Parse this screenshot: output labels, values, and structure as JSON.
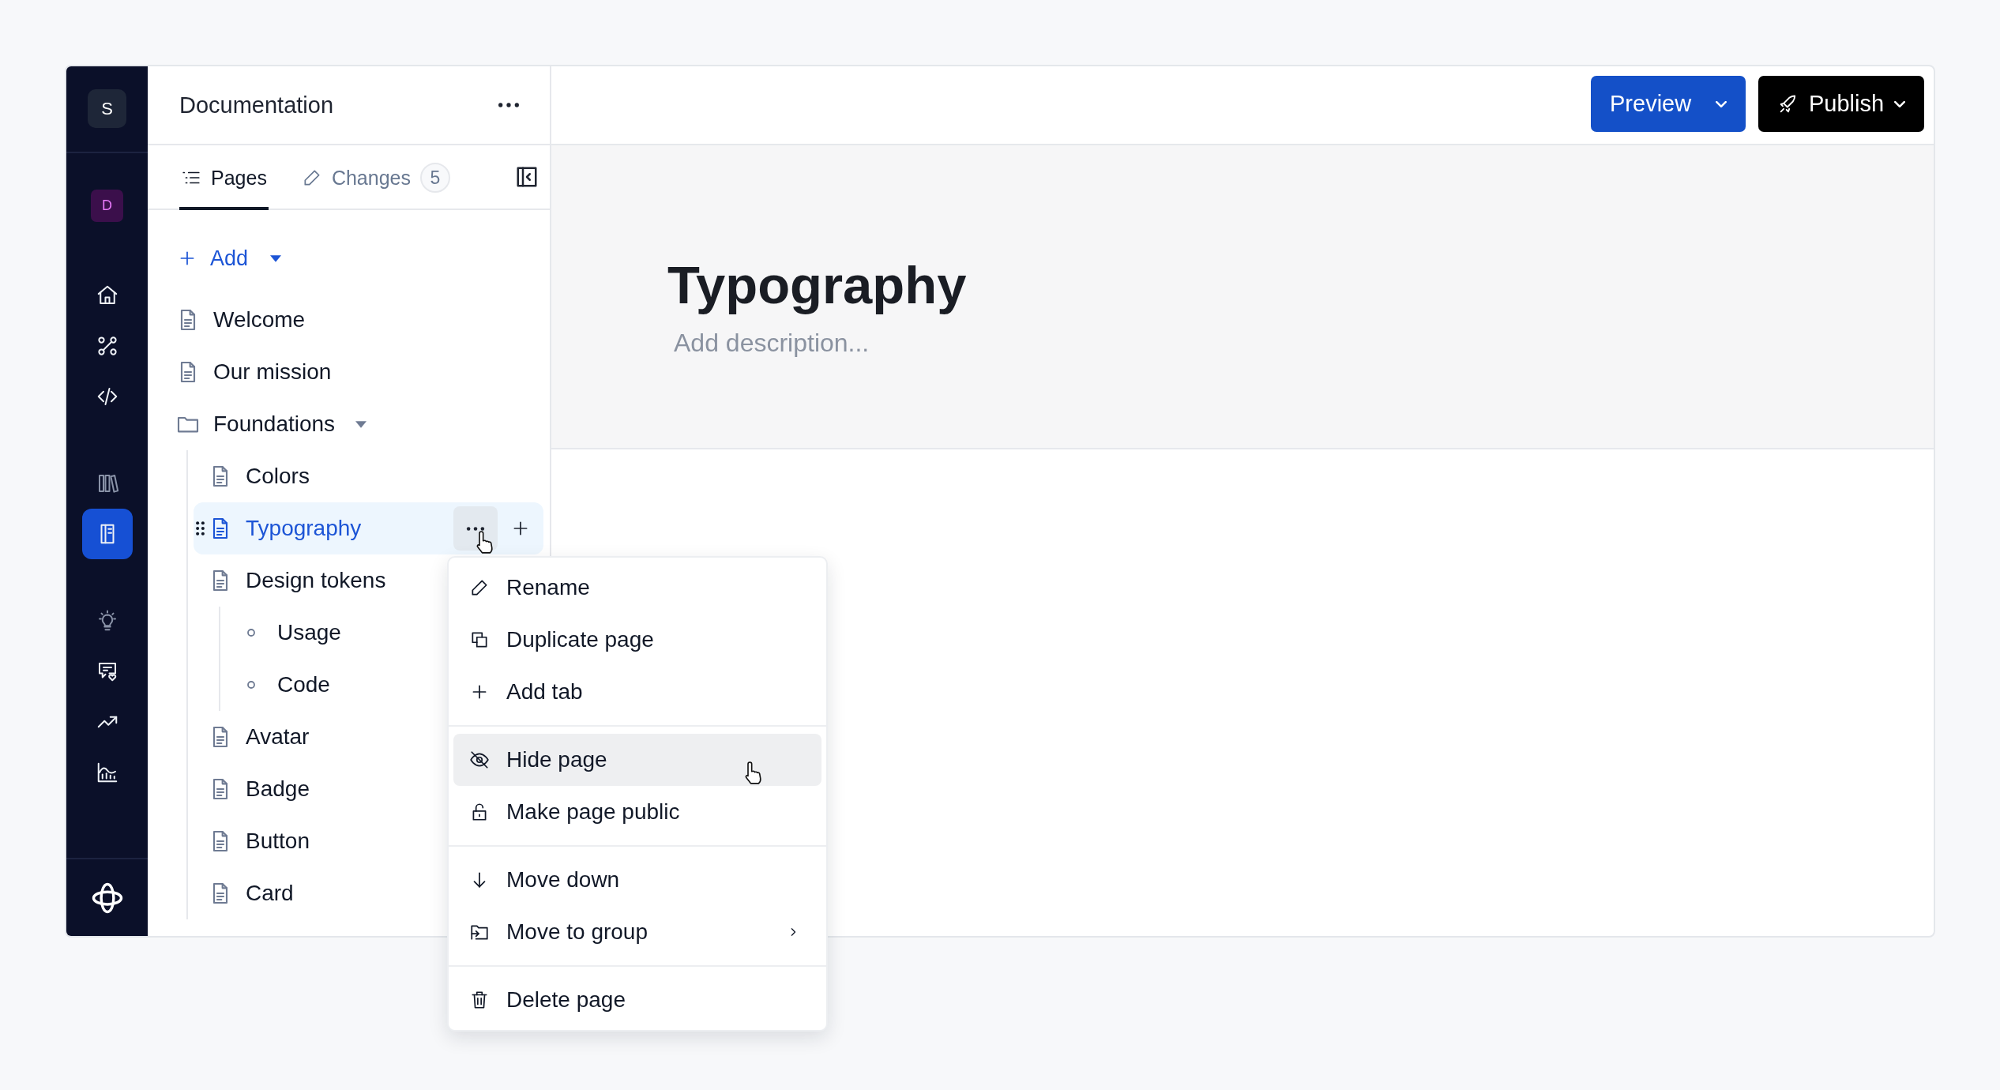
{
  "rail": {
    "workspace_initial": "S",
    "project_initial": "D",
    "groups": [
      [
        {
          "kind": "home",
          "selected": false
        },
        {
          "kind": "nodes",
          "selected": false
        },
        {
          "kind": "code",
          "selected": false
        }
      ],
      [
        {
          "kind": "library",
          "selected": false
        },
        {
          "kind": "book",
          "selected": true
        }
      ],
      [
        {
          "kind": "bulb",
          "selected": false
        },
        {
          "kind": "chat",
          "selected": false
        },
        {
          "kind": "trend",
          "selected": false
        },
        {
          "kind": "chart",
          "selected": false
        }
      ]
    ]
  },
  "sidebar": {
    "title": "Documentation",
    "tabs": [
      {
        "label": "Pages",
        "kind": "pages",
        "selected": true
      },
      {
        "label": "Changes",
        "kind": "changes",
        "count": "5",
        "selected": false
      }
    ],
    "add_label": "Add",
    "tree": [
      {
        "label": "Welcome",
        "kind": "page",
        "selected": false
      },
      {
        "label": "Our mission",
        "kind": "page",
        "selected": false
      },
      {
        "label": "Foundations",
        "kind": "folder",
        "selected": false,
        "expanded": true,
        "children": [
          {
            "label": "Colors",
            "kind": "page",
            "selected": false
          },
          {
            "label": "Typography",
            "kind": "page",
            "selected": true
          },
          {
            "label": "Design tokens",
            "kind": "page",
            "selected": false,
            "children": [
              {
                "label": "Usage",
                "kind": "tab",
                "selected": false
              },
              {
                "label": "Code",
                "kind": "tab",
                "selected": false
              }
            ]
          },
          {
            "label": "Avatar",
            "kind": "page",
            "selected": false
          },
          {
            "label": "Badge",
            "kind": "page",
            "selected": false
          },
          {
            "label": "Button",
            "kind": "page",
            "selected": false
          },
          {
            "label": "Card",
            "kind": "page",
            "selected": false
          }
        ]
      }
    ]
  },
  "toolbar": {
    "buttons": [
      {
        "label": "Preview",
        "kind": "preview"
      },
      {
        "label": "Publish",
        "kind": "publish"
      }
    ]
  },
  "page": {
    "title": "Typography",
    "description_placeholder": "Add description..."
  },
  "context_menu": {
    "groups": [
      [
        {
          "label": "Rename",
          "kind": "pencil",
          "selected": false
        },
        {
          "label": "Duplicate page",
          "kind": "copy",
          "selected": false
        },
        {
          "label": "Add tab",
          "kind": "plus",
          "selected": false
        }
      ],
      [
        {
          "label": "Hide page",
          "kind": "eyeoff",
          "selected": true
        },
        {
          "label": "Make page public",
          "kind": "unlock",
          "selected": false
        }
      ],
      [
        {
          "label": "Move down",
          "kind": "down",
          "selected": false
        },
        {
          "label": "Move to group",
          "kind": "move",
          "selected": false,
          "submenu": true
        }
      ],
      [
        {
          "label": "Delete page",
          "kind": "trash",
          "selected": false
        }
      ]
    ]
  }
}
